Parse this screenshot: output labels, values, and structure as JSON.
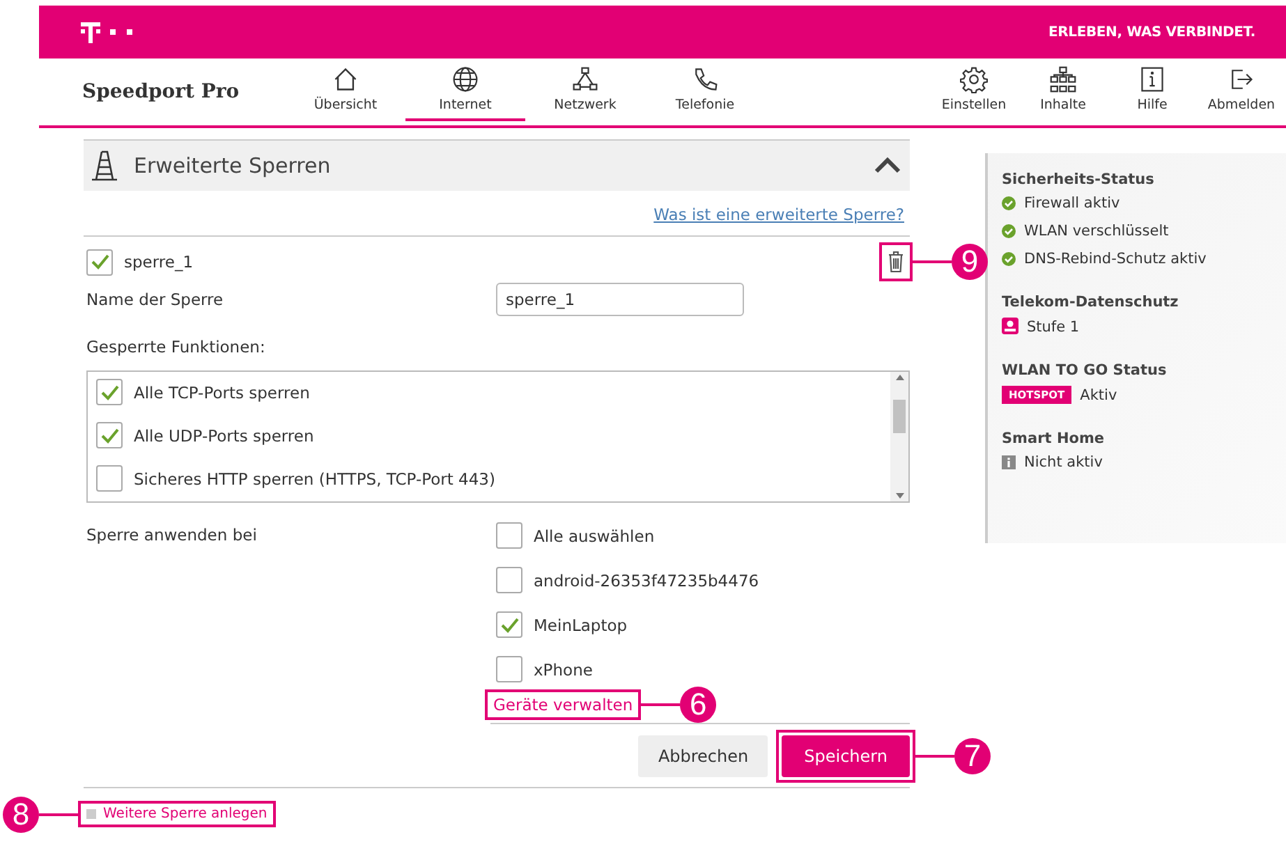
{
  "header": {
    "slogan": "ERLEBEN, WAS VERBINDET."
  },
  "nav": {
    "brand": "Speedport Pro",
    "items": [
      {
        "label": "Übersicht",
        "selected": false
      },
      {
        "label": "Internet",
        "selected": true
      },
      {
        "label": "Netzwerk",
        "selected": false
      },
      {
        "label": "Telefonie",
        "selected": false
      }
    ],
    "tools": [
      {
        "label": "Einstellen"
      },
      {
        "label": "Inhalte"
      },
      {
        "label": "Hilfe"
      },
      {
        "label": "Abmelden"
      }
    ]
  },
  "section": {
    "title": "Erweiterte Sperren",
    "expanded": true,
    "help_link": "Was ist eine erweiterte Sperre?",
    "rule": {
      "name": "sperre_1",
      "checked": true,
      "delete_callout": "9"
    },
    "name_label": "Name der Sperre",
    "name_value": "sperre_1",
    "functions_label": "Gesperrte Funktionen:",
    "functions": [
      {
        "label": "Alle TCP-Ports sperren",
        "checked": true
      },
      {
        "label": "Alle UDP-Ports sperren",
        "checked": true
      },
      {
        "label": "Sicheres HTTP sperren (HTTPS, TCP-Port 443)",
        "checked": false
      }
    ],
    "apply_label": "Sperre anwenden bei",
    "devices": [
      {
        "label": "Alle auswählen",
        "checked": false
      },
      {
        "label": "android-26353f47235b4476",
        "checked": false
      },
      {
        "label": "MeinLaptop",
        "checked": true
      },
      {
        "label": "xPhone",
        "checked": false
      }
    ],
    "manage_link": {
      "label": "Geräte verwalten",
      "callout": "6"
    },
    "buttons": [
      {
        "label": "Abbrechen",
        "kind": "secondary"
      },
      {
        "label": "Speichern",
        "kind": "primary",
        "callout": "7"
      }
    ]
  },
  "add_link": {
    "label": "Weitere Sperre anlegen",
    "callout": "8"
  },
  "sidebar": [
    {
      "title": "Sicherheits-Status",
      "items": [
        {
          "kind": "ok",
          "label": "Firewall aktiv"
        },
        {
          "kind": "ok",
          "label": "WLAN verschlüsselt"
        },
        {
          "kind": "ok",
          "label": "DNS-Rebind-Schutz aktiv"
        }
      ]
    },
    {
      "title": "Telekom-Datenschutz",
      "items": [
        {
          "kind": "privacy",
          "label": "Stufe 1"
        }
      ]
    },
    {
      "title": "WLAN TO GO Status",
      "items": [
        {
          "kind": "hotspot",
          "badge": "HOTSPOT",
          "label": "Aktiv"
        }
      ]
    },
    {
      "title": "Smart Home",
      "items": [
        {
          "kind": "info",
          "label": "Nicht aktiv"
        }
      ]
    }
  ]
}
